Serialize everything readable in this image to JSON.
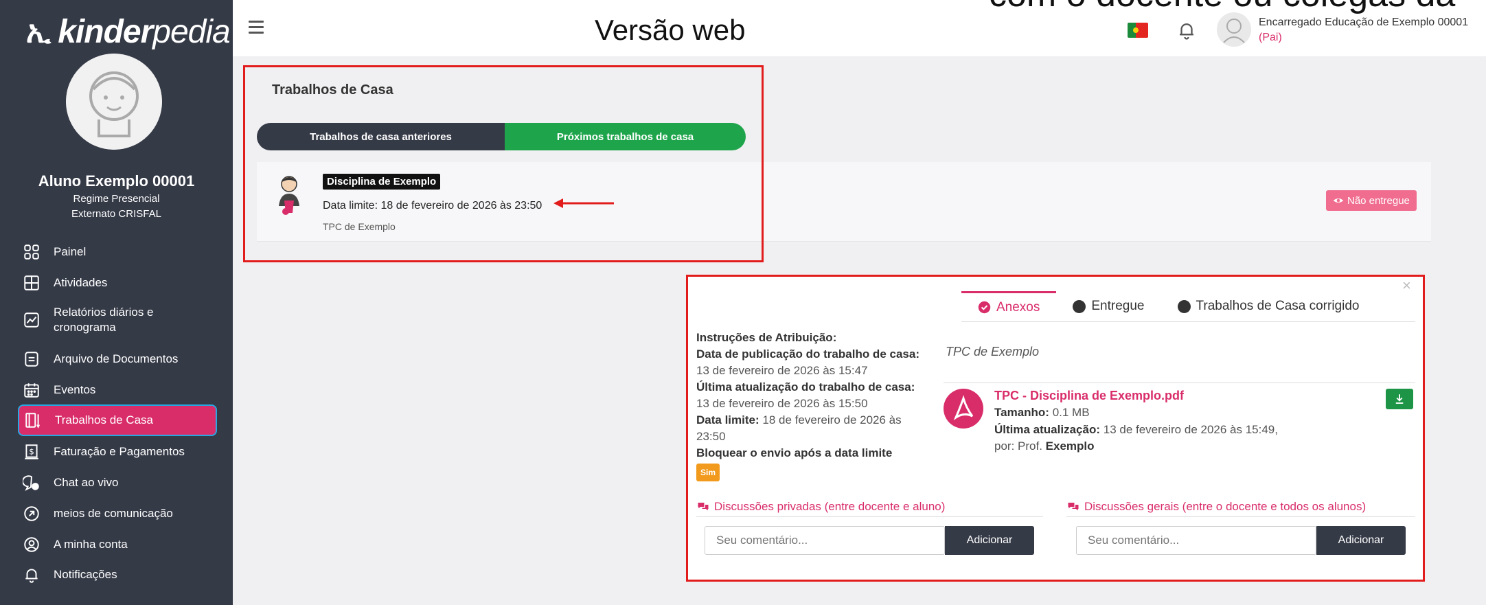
{
  "brand": {
    "name_bold": "kinder",
    "name_rest": "pedia"
  },
  "header": {
    "title": "Versão web",
    "overlay_text": "com o docente ou colegas da",
    "guardian_name": "Encarregado Educação de Exemplo 00001",
    "guardian_role": "(Pai)"
  },
  "student": {
    "name": "Aluno Exemplo 00001",
    "regime": "Regime Presencial",
    "school": "Externato CRISFAL"
  },
  "sidebar": {
    "items": [
      {
        "label": "Painel",
        "icon": "grid-icon"
      },
      {
        "label": "Atividades",
        "icon": "layout-icon"
      },
      {
        "label": "Relatórios diários e cronograma",
        "icon": "chart-icon"
      },
      {
        "label": "Arquivo de Documentos",
        "icon": "document-icon"
      },
      {
        "label": "Eventos",
        "icon": "calendar-icon"
      },
      {
        "label": "Trabalhos de Casa",
        "icon": "homework-icon",
        "active": true
      },
      {
        "label": "Faturação e Pagamentos",
        "icon": "invoice-icon"
      },
      {
        "label": "Chat ao vivo",
        "icon": "chat-icon"
      },
      {
        "label": "meios de comunicação",
        "icon": "media-icon"
      },
      {
        "label": "A minha conta",
        "icon": "account-icon"
      },
      {
        "label": "Notificações",
        "icon": "bell-icon"
      }
    ]
  },
  "homework": {
    "title": "Trabalhos de Casa",
    "tab_previous": "Trabalhos de casa anteriores",
    "tab_next": "Próximos trabalhos de casa",
    "subject": "Disciplina de Exemplo",
    "deadline": "Data limite: 18 de fevereiro de 2026 às 23:50",
    "description": "TPC de Exemplo",
    "status": "Não entregue"
  },
  "detail": {
    "tabs": [
      "Anexos",
      "Entregue",
      "Trabalhos de Casa corrigido"
    ],
    "instructions_title": "Instruções de Atribuição:",
    "published_label": "Data de publicação do trabalho de casa:",
    "published_value": "13 de fevereiro de 2026 às 15:47",
    "updated_label": "Última atualização do trabalho de casa:",
    "updated_value": "13 de fevereiro de 2026 às 15:50",
    "deadline_label": "Data limite:",
    "deadline_value": "18 de fevereiro de 2026 às 23:50",
    "block_label": "Bloquear o envio após a data limite",
    "block_value": "Sim",
    "tpc_text": "TPC de Exemplo",
    "file_name": "TPC - Disciplina de Exemplo.pdf",
    "size_label": "Tamanho:",
    "size_value": "0.1 MB",
    "file_updated_label": "Última atualização:",
    "file_updated_value": "13 de fevereiro de 2026 às 15:49, por: Prof.",
    "file_updated_author": "Exemplo",
    "private_discussion": "Discussões privadas (entre docente e aluno)",
    "general_discussion": "Discussões gerais (entre o docente e todos os alunos)",
    "comment_placeholder": "Seu comentário...",
    "add_label": "Adicionar"
  },
  "colors": {
    "sidebar_bg": "#353a47",
    "accent_pink": "#d92d6a",
    "green": "#1ea54b",
    "annotation_red": "#e21c1c"
  }
}
